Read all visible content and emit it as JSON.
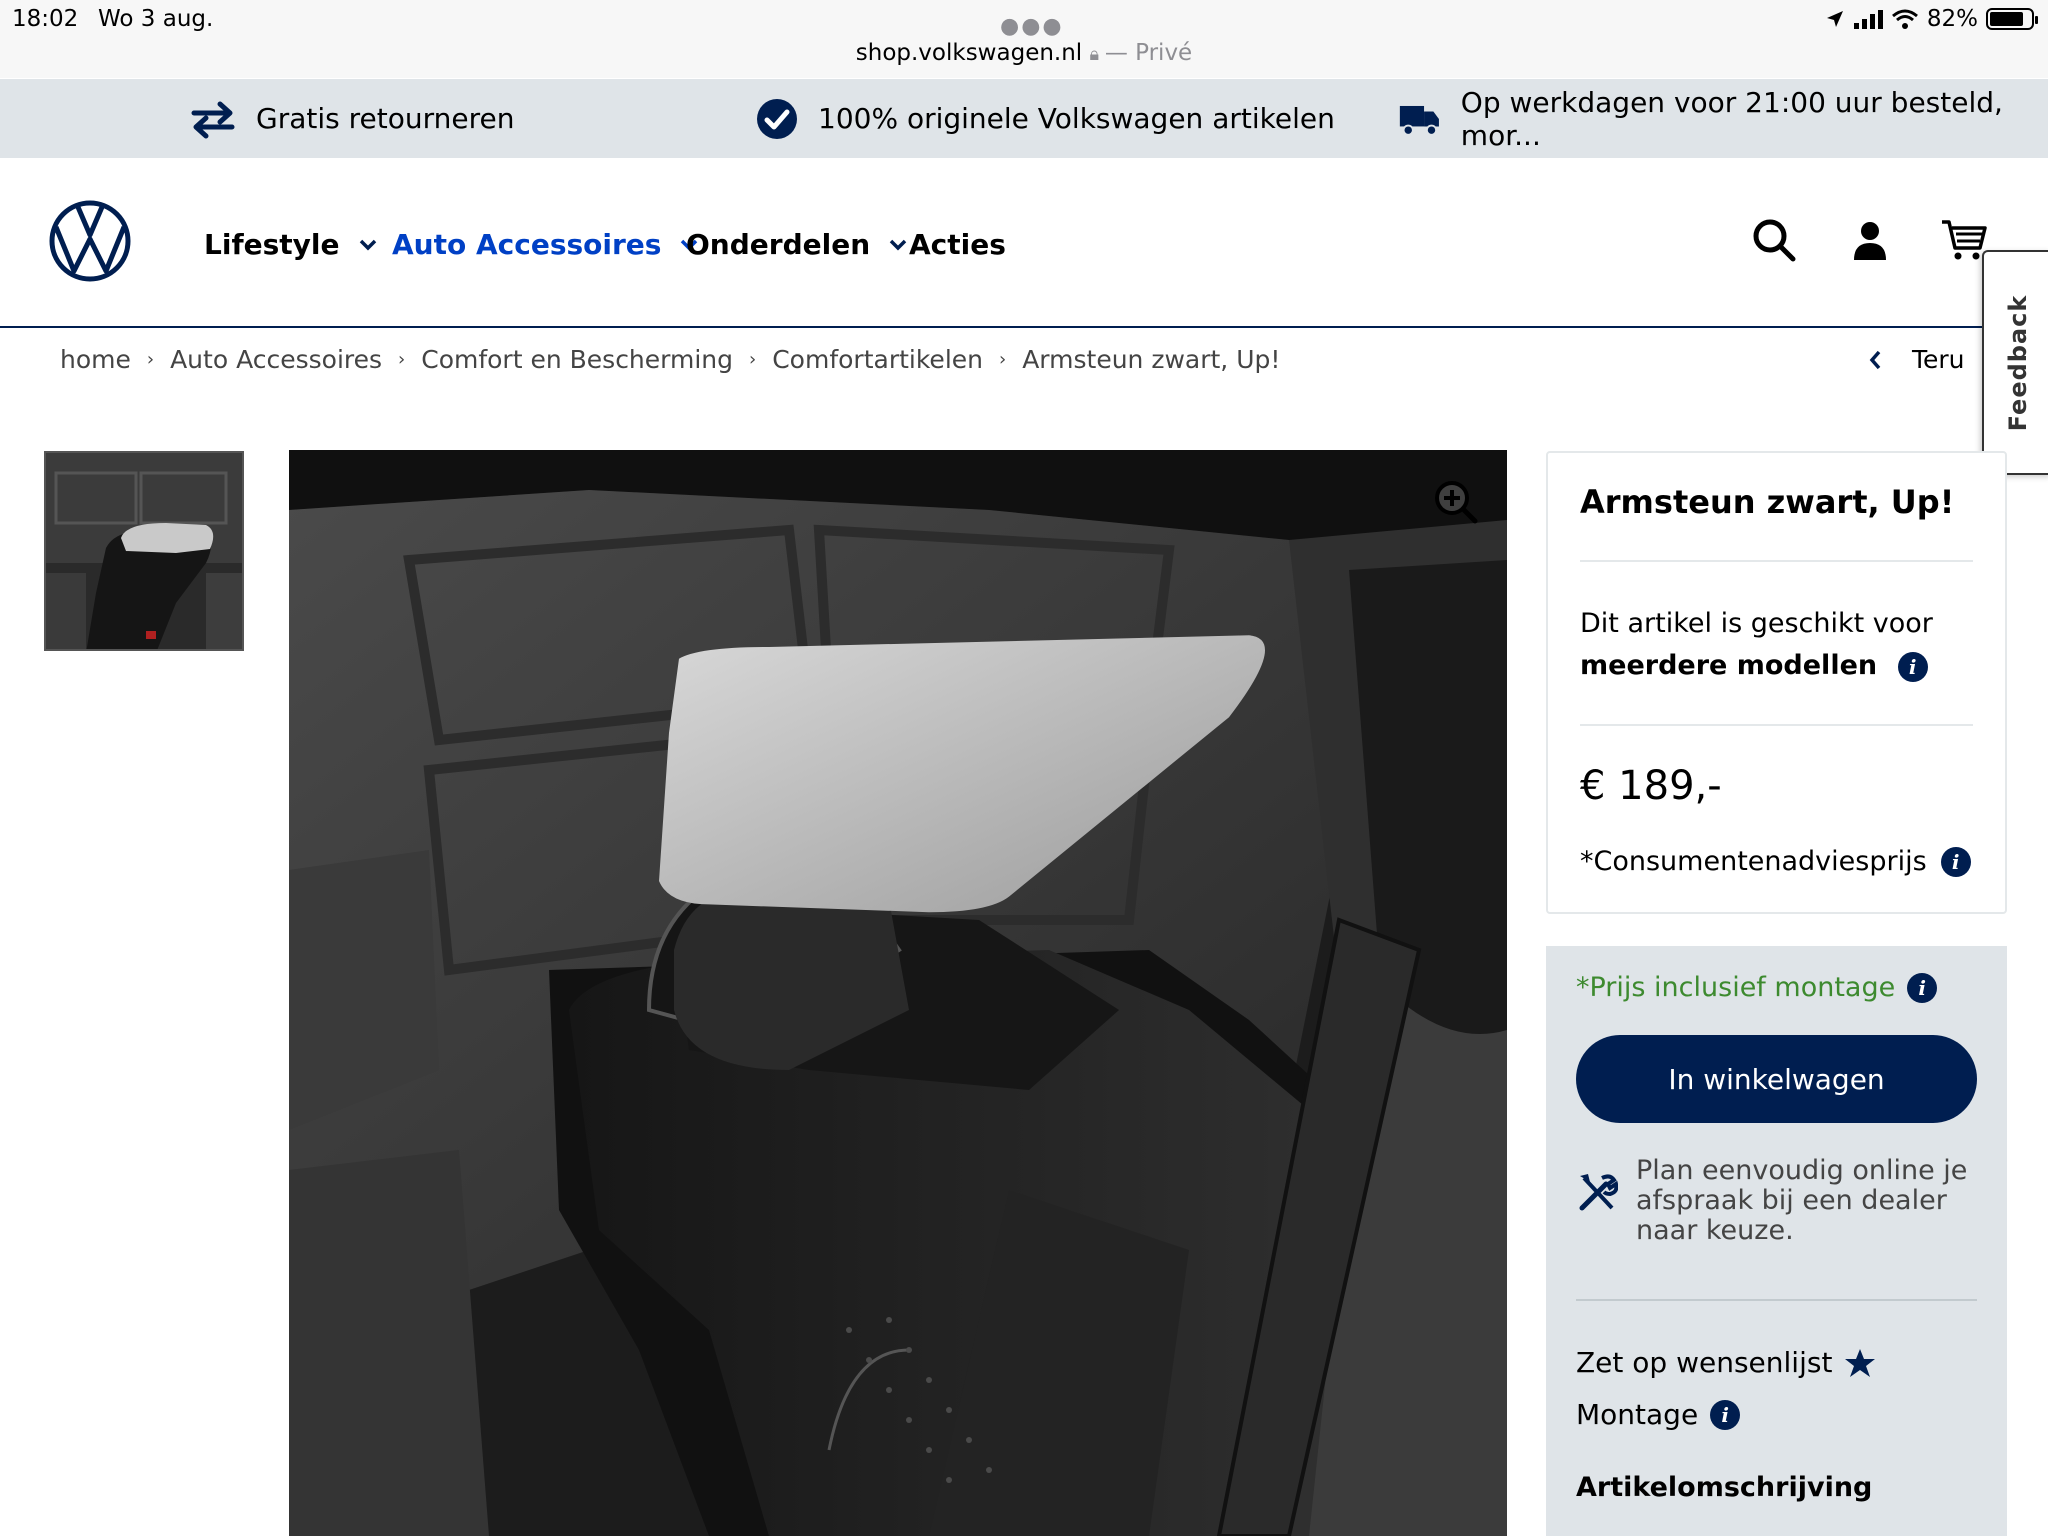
{
  "status_bar": {
    "time": "18:02",
    "date": "Wo 3 aug.",
    "battery": "82%",
    "battery_level": 0.82,
    "url": "shop.volkswagen.nl",
    "private_label": "— Privé"
  },
  "usp": [
    {
      "icon": "return-arrows-icon",
      "label": "Gratis retourneren"
    },
    {
      "icon": "check-circle-icon",
      "label": "100% originele Volkswagen artikelen"
    },
    {
      "icon": "delivery-truck-icon",
      "label": "Op werkdagen voor 21:00 uur besteld, mor..."
    }
  ],
  "nav": {
    "items": [
      {
        "label": "Lifestyle",
        "dropdown": true
      },
      {
        "label": "Auto Accessoires",
        "dropdown": true,
        "active": true
      },
      {
        "label": "Onderdelen",
        "dropdown": true
      },
      {
        "label": "Acties",
        "dropdown": false
      }
    ],
    "icons": [
      "search-icon",
      "account-icon",
      "cart-icon"
    ]
  },
  "breadcrumb": [
    "home",
    "Auto Accessoires",
    "Comfort en Bescherming",
    "Comfortartikelen",
    "Armsteun zwart, Up!"
  ],
  "back_label": "Teru",
  "feedback_label": "Feedback",
  "product": {
    "title": "Armsteun zwart, Up!",
    "fit_text": "Dit artikel is geschikt voor",
    "fit_bold": "meerdere modellen",
    "price": "€ 189,-",
    "advice_label": "*Consumentenadviesprijs",
    "incl_label": "*Prijs inclusief montage",
    "cart_button": "In winkelwagen",
    "plan_text": "Plan eenvoudig online je afspraak bij een dealer naar keuze.",
    "wishlist_label": "Zet op wensenlijst",
    "montage_label": "Montage",
    "description_label": "Artikelomschrijving"
  },
  "colors": {
    "vw_blue": "#001e50",
    "nav_active": "#0040c5",
    "usp_bg": "#dfe4e8",
    "incl_green": "#3d8a2f"
  }
}
